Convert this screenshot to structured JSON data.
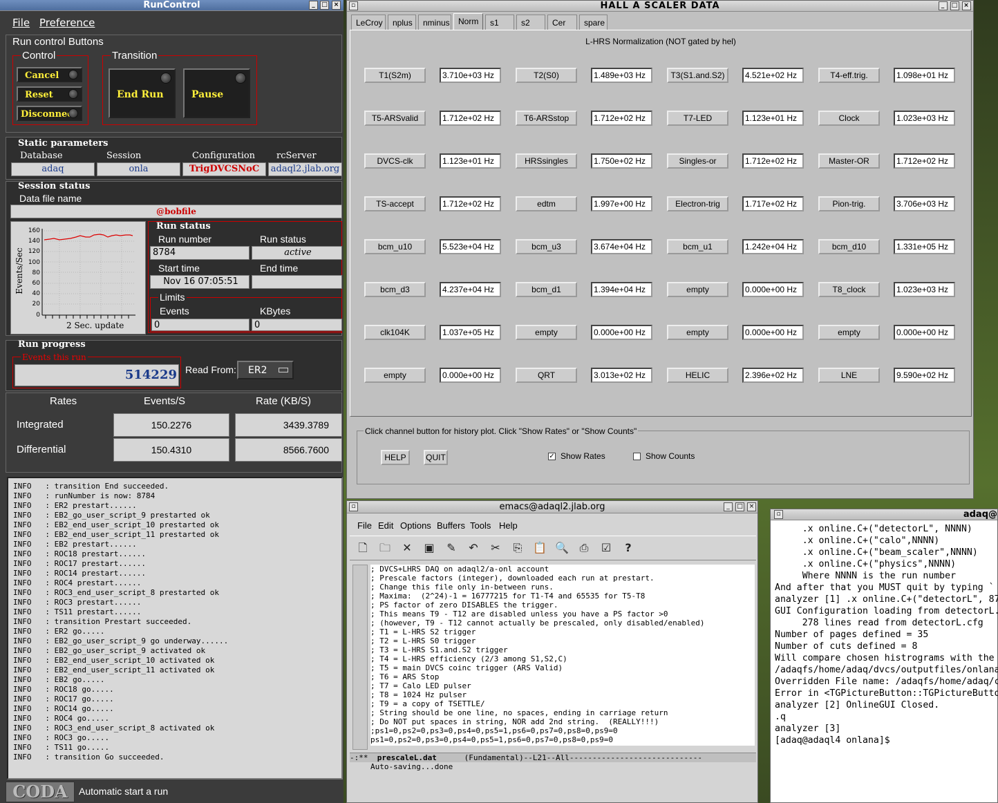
{
  "runcontrol": {
    "title": "RunControl",
    "menu": [
      "File",
      "Preference"
    ],
    "buttons_group": "Run control Buttons",
    "control_label": "Control",
    "control_buttons": [
      "Cancel",
      "Reset",
      "Disconnect"
    ],
    "transition_label": "Transition",
    "transition_buttons": [
      "End Run",
      "Pause"
    ],
    "static_params_label": "Static parameters",
    "static_params": [
      {
        "header": "Database",
        "value": "adaq"
      },
      {
        "header": "Session",
        "value": "onla"
      },
      {
        "header": "Configuration",
        "value": "TrigDVCSNoC"
      },
      {
        "header": "rcServer",
        "value": "adaql2.jlab.org"
      }
    ],
    "session_status_label": "Session status",
    "data_file_label": "Data file name",
    "data_file_value": "@bobfile",
    "plot": {
      "ylabel": "Events/Sec",
      "caption": "2 Sec. update",
      "y_ticks": [
        "160",
        "140",
        "120",
        "100",
        "80",
        "60",
        "40",
        "20",
        "0"
      ]
    },
    "run_status_label": "Run status",
    "run_number_label": "Run number",
    "run_number": "8784",
    "run_status_head": "Run status",
    "run_status_value": "active",
    "start_time_label": "Start time",
    "start_time": "Nov 16 07:05:51",
    "end_time_label": "End time",
    "end_time": "",
    "limits_label": "Limits",
    "events_label": "Events",
    "events_limit": "0",
    "kbytes_label": "KBytes",
    "kbytes_limit": "0",
    "run_progress_label": "Run progress",
    "events_this_run_label": "Events this run",
    "events_this_run": "514229",
    "read_from_label": "Read From:",
    "read_from_value": "ER2",
    "rates_header": [
      "Rates",
      "Events/S",
      "Rate (KB/S)"
    ],
    "rates": [
      {
        "label": "Integrated",
        "events": "150.2276",
        "rate": "3439.3789"
      },
      {
        "label": "Differential",
        "events": "150.4310",
        "rate": "8566.7600"
      }
    ],
    "log": [
      "INFO   : transition End succeeded.",
      "INFO   : runNumber is now: 8784",
      "INFO   : ER2 prestart......",
      "INFO   : EB2_go_user_script_9 prestarted ok",
      "INFO   : EB2_end_user_script_10 prestarted ok",
      "INFO   : EB2_end_user_script_11 prestarted ok",
      "INFO   : EB2 prestart......",
      "INFO   : ROC18 prestart......",
      "INFO   : ROC17 prestart......",
      "INFO   : ROC14 prestart......",
      "INFO   : ROC4 prestart......",
      "INFO   : ROC3_end_user_script_8 prestarted ok",
      "INFO   : ROC3 prestart......",
      "INFO   : TS11 prestart......",
      "INFO   : transition Prestart succeeded.",
      "INFO   : ER2 go.....",
      "INFO   : EB2_go_user_script_9 go underway......",
      "INFO   : EB2_go_user_script_9 activated ok",
      "INFO   : EB2_end_user_script_10 activated ok",
      "INFO   : EB2_end_user_script_11 activated ok",
      "INFO   : EB2 go.....",
      "INFO   : ROC18 go.....",
      "INFO   : ROC17 go.....",
      "INFO   : ROC14 go.....",
      "INFO   : ROC4 go.....",
      "INFO   : ROC3_end_user_script_8 activated ok",
      "INFO   : ROC3 go.....",
      "INFO   : TS11 go.....",
      "INFO   : transition Go succeeded."
    ],
    "coda_logo": "CODA",
    "status_bar": "Automatic start a run"
  },
  "scaler": {
    "title": "HALL  A   SCALER  DATA",
    "tabs": [
      "LeCroy",
      "nplus",
      "nminus",
      "Norm",
      "s1",
      "s2",
      "Cer",
      "spare"
    ],
    "heading": "L-HRS Normalization (NOT gated by hel)",
    "channels": [
      [
        [
          "T1(S2m)",
          "3.710e+03 Hz"
        ],
        [
          "T2(S0)",
          "1.489e+03 Hz"
        ],
        [
          "T3(S1.and.S2)",
          "4.521e+02 Hz"
        ],
        [
          "T4-eff.trig.",
          "1.098e+01 Hz"
        ]
      ],
      [
        [
          "T5-ARSvalid",
          "1.712e+02 Hz"
        ],
        [
          "T6-ARSstop",
          "1.712e+02 Hz"
        ],
        [
          "T7-LED",
          "1.123e+01 Hz"
        ],
        [
          "Clock",
          "1.023e+03 Hz"
        ]
      ],
      [
        [
          "DVCS-clk",
          "1.123e+01 Hz"
        ],
        [
          "HRSsingles",
          "1.750e+02 Hz"
        ],
        [
          "Singles-or",
          "1.712e+02 Hz"
        ],
        [
          "Master-OR",
          "1.712e+02 Hz"
        ]
      ],
      [
        [
          "TS-accept",
          "1.712e+02 Hz"
        ],
        [
          "edtm",
          "1.997e+00 Hz"
        ],
        [
          "Electron-trig",
          "1.717e+02 Hz"
        ],
        [
          "Pion-trig.",
          "3.706e+03 Hz"
        ]
      ],
      [
        [
          "bcm_u10",
          "5.523e+04 Hz"
        ],
        [
          "bcm_u3",
          "3.674e+04 Hz"
        ],
        [
          "bcm_u1",
          "1.242e+04 Hz"
        ],
        [
          "bcm_d10",
          "1.331e+05 Hz"
        ]
      ],
      [
        [
          "bcm_d3",
          "4.237e+04 Hz"
        ],
        [
          "bcm_d1",
          "1.394e+04 Hz"
        ],
        [
          "empty",
          "0.000e+00 Hz"
        ],
        [
          "T8_clock",
          "1.023e+03 Hz"
        ]
      ],
      [
        [
          "clk104K",
          "1.037e+05 Hz"
        ],
        [
          "empty",
          "0.000e+00 Hz"
        ],
        [
          "empty",
          "0.000e+00 Hz"
        ],
        [
          "empty",
          "0.000e+00 Hz"
        ]
      ],
      [
        [
          "empty",
          "0.000e+00 Hz"
        ],
        [
          "QRT",
          "3.013e+02 Hz"
        ],
        [
          "HELIC",
          "2.396e+02 Hz"
        ],
        [
          "LNE",
          "9.590e+02 Hz"
        ]
      ]
    ],
    "instructions": "Click channel button for history plot.  Click \"Show Rates\" or \"Show Counts\"",
    "help": "HELP",
    "quit": "QUIT",
    "show_rates": "Show Rates",
    "show_counts": "Show Counts"
  },
  "emacs": {
    "title": "emacs@adaql2.jlab.org",
    "menu": [
      "File",
      "Edit",
      "Options",
      "Buffers",
      "Tools",
      "Help"
    ],
    "lines": [
      "; DVCS+LHRS DAQ on adaql2/a-onl account",
      "; Prescale factors (integer), downloaded each run at prestart.",
      "; Change this file only in-between runs.",
      "; Maxima:  (2^24)-1 = 16777215 for T1-T4 and 65535 for T5-T8",
      "; PS factor of zero DISABLES the trigger.",
      "; This means T9 - T12 are disabled unless you have a PS factor >0",
      "; (however, T9 - T12 cannot actually be prescaled, only disabled/enabled)",
      "; T1 = L-HRS S2 trigger",
      "; T2 = L-HRS S0 trigger",
      "; T3 = L-HRS S1.and.S2 trigger",
      "; T4 = L-HRS efficiency (2/3 among S1,S2,C)",
      "; T5 = main DVCS coinc trigger (ARS Valid)",
      "; T6 = ARS Stop",
      "; T7 = Calo LED pulser",
      "; T8 = 1024 Hz pulser",
      "; T9 = a copy of TSETTLE/",
      "; String should be one line, no spaces, ending in carriage return",
      "; Do NOT put spaces in string, NOR add 2nd string.  (REALLY!!!)",
      ";ps1=0,ps2=0,ps3=0,ps4=0,ps5=1,ps6=0,ps7=0,ps8=0,ps9=0",
      "ps1=0,ps2=0,ps3=0,ps4=0,ps5=1,ps6=0,ps7=0,ps8=0,ps9=0"
    ],
    "modeline_left": "-:**",
    "modeline_file": "prescaleL.dat",
    "modeline_right": "(Fundamental)--L21--All-----------------------------",
    "minibuffer": "Auto-saving...done"
  },
  "terminal": {
    "title": "adaq@",
    "lines": [
      "     .x online.C+(\"detectorL\", NNNN)",
      "     .x online.C+(\"calo\",NNNN)",
      "     .x online.C+(\"beam_scaler\",NNNN)",
      "     .x online.C+(\"physics\",NNNN)",
      "     Where NNNN is the run number",
      "",
      "And after that you MUST quit by typing `",
      "",
      "analyzer [1] .x online.C+(\"detectorL\", 87",
      "GUI Configuration loading from detectorL.",
      "     278 lines read from detectorL.cfg",
      "Number of pages defined = 35",
      "Number of cuts defined = 8",
      "Will compare chosen histrograms with the",
      "/adaqfs/home/adaq/dvcs/outputfiles/onlana",
      "Overridden File name: /adaqfs/home/adaq/c",
      "Error in <TGPictureButton::TGPictureButto",
      "analyzer [2] OnlineGUI Closed.",
      ".q",
      "analyzer [3]",
      "[adaq@adaql4 onlana]$ "
    ]
  }
}
